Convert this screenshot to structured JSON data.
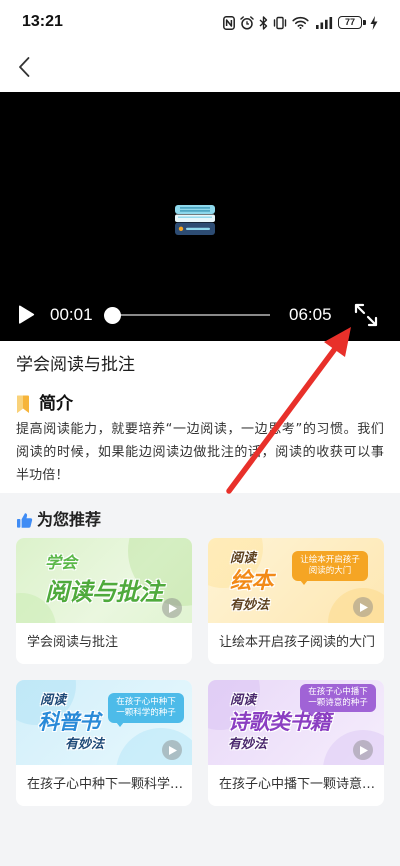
{
  "status_bar": {
    "time": "13:21",
    "battery_level": "77",
    "icons": [
      "nfc-icon",
      "alarm-icon",
      "bluetooth-icon",
      "vibrate-icon",
      "wifi-icon",
      "signal-icon",
      "battery-icon",
      "charging-icon"
    ]
  },
  "nav": {
    "back_icon": "chevron-left-icon"
  },
  "video": {
    "center_icon": "book-stack-icon",
    "play_icon": "play-icon",
    "fullscreen_icon": "fullscreen-expand-icon",
    "current_time": "00:01",
    "duration": "06:05",
    "progress": 0.003
  },
  "lesson": {
    "title": "学会阅读与批注"
  },
  "intro": {
    "icon": "bookmark-icon",
    "heading": "简介",
    "text": "提高阅读能力，就要培养“一边阅读，一边思考”的习惯。我们阅读的时候，如果能边阅读边做批注的话，阅读的收获可以事半功倍！"
  },
  "recommend": {
    "icon": "thumbs-up-icon",
    "heading": "为您推荐",
    "cards": [
      {
        "title": "学会阅读与批注",
        "theme_color": "#4faa3c",
        "thumb": {
          "kicker": "学会",
          "headline": "阅读与批注",
          "play_icon": "play-icon"
        }
      },
      {
        "title": "让绘本开启孩子阅读的大门",
        "theme_color": "#f28a18",
        "bubble_color": "#f5a524",
        "thumb": {
          "kicker": "阅读",
          "headline": "绘本",
          "subline": "有妙法",
          "bubble": [
            "让绘本开启孩子",
            "阅读的大门"
          ],
          "play_icon": "play-icon"
        }
      },
      {
        "title": "在孩子心中种下一颗科学…",
        "theme_color": "#2a8ad8",
        "bubble_color": "#4dbbe9",
        "thumb": {
          "kicker": "阅读",
          "headline": "科普书",
          "subline": "有妙法",
          "bubble": [
            "在孩子心中种下",
            "一颗科学的种子"
          ],
          "play_icon": "play-icon"
        }
      },
      {
        "title": "在孩子心中播下一颗诗意…",
        "theme_color": "#8b3fc2",
        "bubble_color": "#a063d6",
        "thumb": {
          "kicker": "阅读",
          "headline": "诗歌类书籍",
          "subline": "有妙法",
          "bubble": [
            "在孩子心中播下",
            "一颗诗意的种子"
          ],
          "play_icon": "play-icon"
        }
      }
    ]
  },
  "colors": {
    "page_bg": "#f3f4f6",
    "video_bg": "#000000",
    "bookmark": "#f6b43a",
    "thumbs_up": "#3f8cf5",
    "annotation_arrow": "#e8302a"
  }
}
